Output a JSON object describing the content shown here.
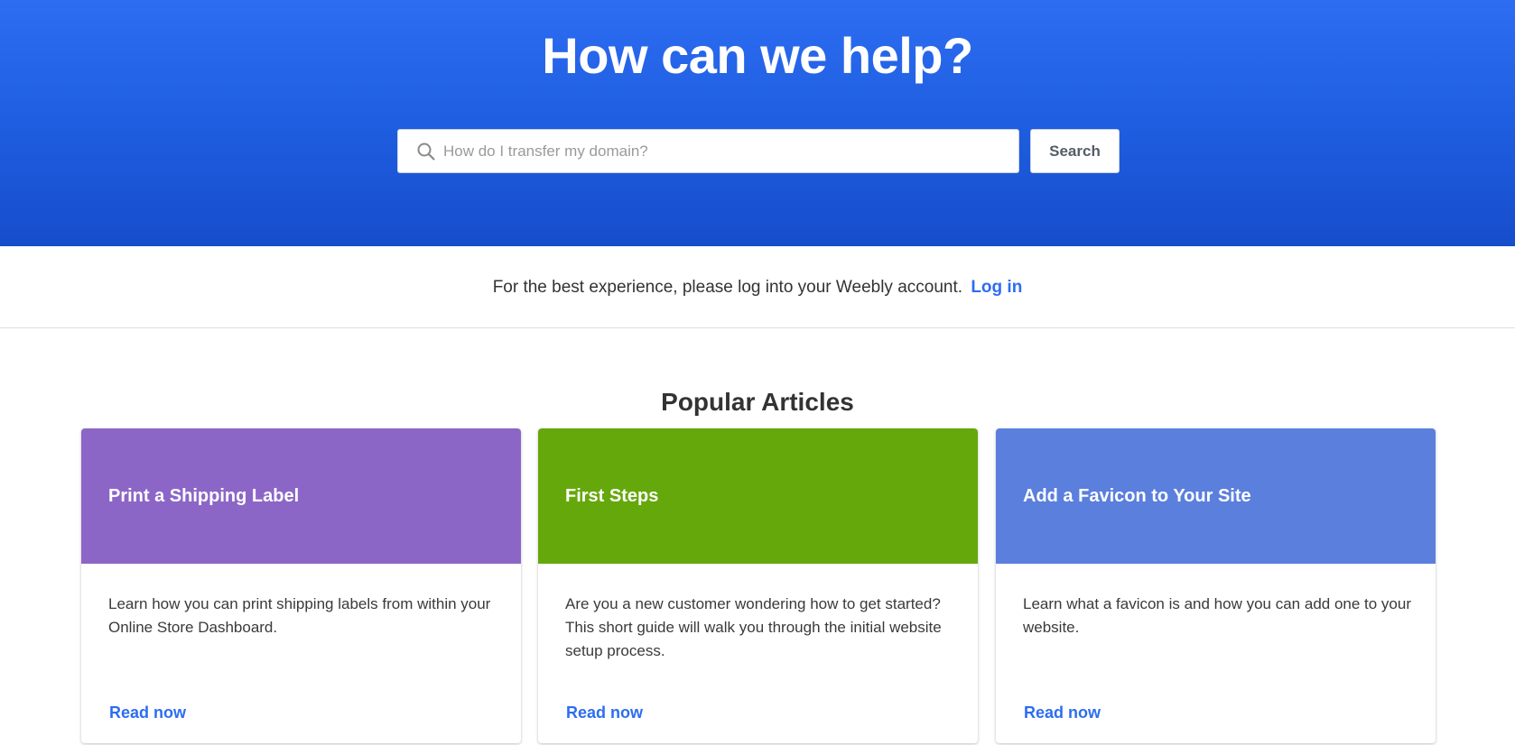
{
  "hero": {
    "title": "How can we help?",
    "background_color": "#2265eb"
  },
  "search": {
    "placeholder": "How do I transfer my domain?",
    "value": "",
    "button_label": "Search",
    "icon": "search-icon"
  },
  "login_prompt": {
    "text": "For the best experience, please log into your Weebly account.",
    "link_label": "Log in",
    "link_color": "#2d6df2"
  },
  "popular": {
    "title": "Popular Articles",
    "cards": [
      {
        "title": "Print a Shipping Label",
        "description": "Learn how you can print shipping labels from within your Online Store Dashboard.",
        "link_label": "Read now",
        "color": "#8c66c7"
      },
      {
        "title": "First Steps",
        "description": "Are you a new customer wondering how to get started? This short guide will walk you through the initial website setup process.",
        "link_label": "Read now",
        "color": "#65a80c"
      },
      {
        "title": "Add a Favicon to Your Site",
        "description": "Learn what a favicon is and how you can add one to your website.",
        "link_label": "Read now",
        "color": "#5b7fdd"
      }
    ]
  }
}
